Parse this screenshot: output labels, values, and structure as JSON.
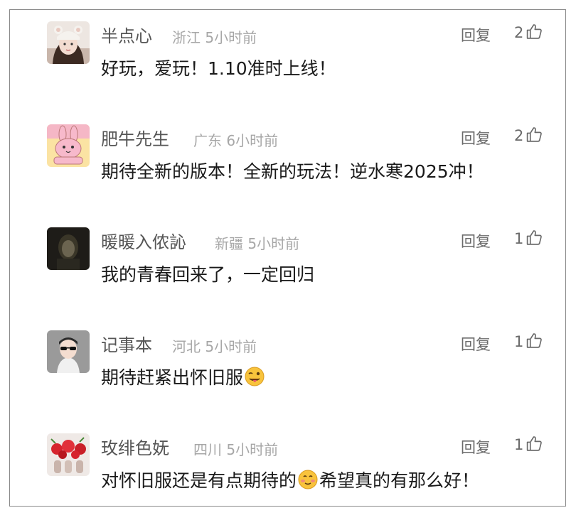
{
  "comments": [
    {
      "user": "半点心",
      "location": "浙江",
      "time": "5小时前",
      "reply_label": "回复",
      "likes": "2",
      "text": "好玩，爱玩！1.10准时上线！",
      "text_after": "",
      "emoji": "",
      "avatar": "girl-with-bear-ears-hat"
    },
    {
      "user": "肥牛先生",
      "location": "广东",
      "time": "6小时前",
      "reply_label": "回复",
      "likes": "2",
      "text": "期待全新的版本！全新的玩法！逆水寒2025冲！",
      "text_after": "",
      "emoji": "",
      "avatar": "pink-rabbit-cartoon"
    },
    {
      "user": "暖暖入侬訫",
      "location": "新疆",
      "time": "5小时前",
      "reply_label": "回复",
      "likes": "1",
      "text": "我的青春回来了，一定回归",
      "text_after": "",
      "emoji": "",
      "avatar": "dark-hooded-figure"
    },
    {
      "user": "记事本",
      "location": "河北",
      "time": "5小时前",
      "reply_label": "回复",
      "likes": "1",
      "text": "期待赶紧出怀旧服",
      "text_after": "",
      "emoji": "winking-tongue-emoji",
      "avatar": "man-with-sunglasses"
    },
    {
      "user": "玫绯色妩",
      "location": "四川",
      "time": "5小时前",
      "reply_label": "回复",
      "likes": "1",
      "text": "对怀旧服还是有点期待的",
      "text_after": "希望真的有那么好！",
      "emoji": "shy-smile-emoji",
      "avatar": "red-flowers-in-vases"
    }
  ],
  "colors": {
    "username": "#555555",
    "meta": "#a7a7a7",
    "action": "#6a6a6a",
    "body_text": "#1a1a1a",
    "border": "#8a8a8a"
  }
}
